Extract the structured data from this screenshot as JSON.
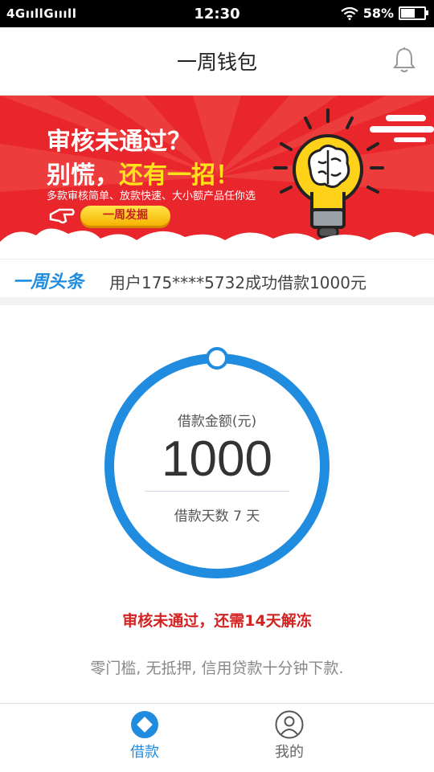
{
  "status_bar": {
    "network": "4GııllGıııll",
    "time": "12:30",
    "battery": "58%"
  },
  "header": {
    "title": "一周钱包",
    "bell_icon": "bell-icon"
  },
  "banner": {
    "headline1": "审核未通过？",
    "headline2_a": "别慌，",
    "headline2_b": "还有一招！",
    "subtext": "多款审核简单、放款快速、大小额产品任你选",
    "button_label": "一周发掘",
    "colors": {
      "background": "#e8262b",
      "accent": "#ffe21a"
    }
  },
  "news": {
    "brand": "一周头条",
    "message": "用户175****5732成功借款1000元"
  },
  "loan": {
    "amount_label": "借款金额(元)",
    "amount": "1000",
    "days_label": "借款天数 7 天",
    "ring_color": "#1f8ce0"
  },
  "warning": "审核未通过，还需14天解冻",
  "slogan": "零门槛, 无抵押, 信用贷款十分钟下款.",
  "tabs": [
    {
      "label": "借款",
      "icon": "loan-icon",
      "active": true
    },
    {
      "label": "我的",
      "icon": "profile-icon",
      "active": false
    }
  ]
}
